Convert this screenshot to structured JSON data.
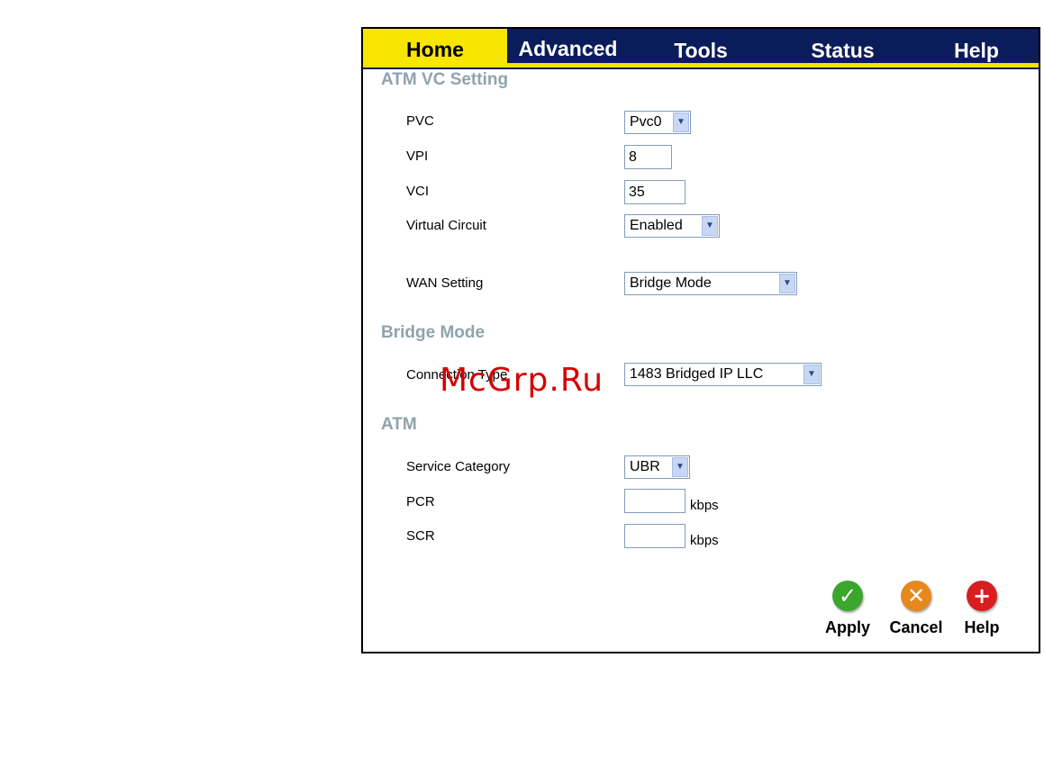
{
  "tabs": [
    {
      "label": "Home"
    },
    {
      "label": "Advanced"
    },
    {
      "label": "Tools"
    },
    {
      "label": "Status"
    },
    {
      "label": "Help"
    }
  ],
  "sections": {
    "atm_vc": "ATM VC Setting",
    "bridge": "Bridge Mode",
    "atm": "ATM"
  },
  "fields": {
    "pvc": {
      "label": "PVC",
      "value": "Pvc0"
    },
    "vpi": {
      "label": "VPI",
      "value": "8"
    },
    "vci": {
      "label": "VCI",
      "value": "35"
    },
    "virtual_circuit": {
      "label": "Virtual Circuit",
      "value": "Enabled"
    },
    "wan_setting": {
      "label": "WAN Setting",
      "value": "Bridge Mode"
    },
    "connection_type": {
      "label": "Connection Type",
      "value": "1483 Bridged IP LLC"
    },
    "service_category": {
      "label": "Service Category",
      "value": "UBR"
    },
    "pcr": {
      "label": "PCR",
      "value": "",
      "unit": "kbps"
    },
    "scr": {
      "label": "SCR",
      "value": "",
      "unit": "kbps"
    }
  },
  "buttons": {
    "apply": "Apply",
    "cancel": "Cancel",
    "help": "Help"
  },
  "watermark": "McGrp.Ru",
  "colors": {
    "tab_bar": "#0a1d5a",
    "tab_active": "#f7e600",
    "section_heading": "#8fa3ad",
    "apply": "#3aa62c",
    "cancel": "#e6891c",
    "help": "#d81e1e"
  }
}
